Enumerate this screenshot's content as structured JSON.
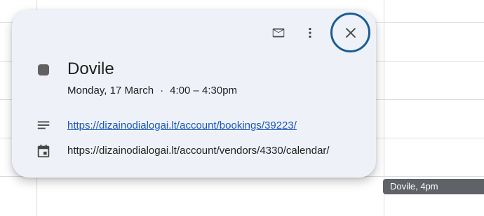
{
  "event": {
    "title": "Dovile",
    "date": "Monday, 17 March",
    "separator": "·",
    "time": "4:00 – 4:30pm",
    "color": "#616161",
    "description_link": "https://dizainodialogai.lt/account/bookings/39223/",
    "calendar_url": "https://dizainodialogai.lt/account/vendors/4330/calendar/"
  },
  "toolbar": {
    "email_icon": "email-icon",
    "more_icon": "more-vert-icon",
    "close_icon": "close-icon"
  },
  "tooltip": {
    "text": "Dovile, 4pm"
  },
  "colors": {
    "card_bg": "#eef2f8",
    "link": "#1a57b7",
    "focus_ring": "#1b5c95",
    "tooltip_bg": "#5f6368"
  }
}
